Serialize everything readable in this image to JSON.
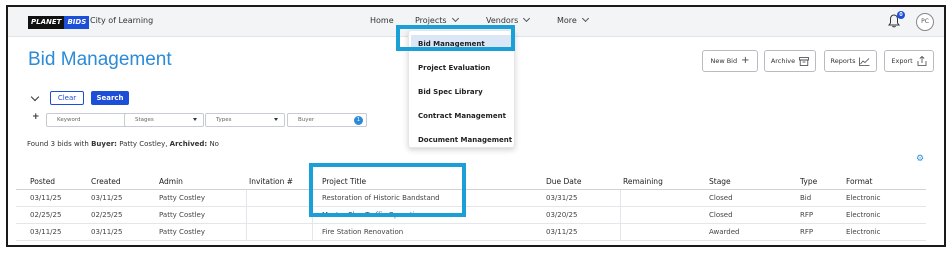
{
  "topbar": {
    "logo_part1": "PLANET",
    "logo_part2": "BIDS",
    "org_name": "City of Learning",
    "nav": [
      {
        "label": "Home",
        "has_chevron": false
      },
      {
        "label": "Projects",
        "has_chevron": true
      },
      {
        "label": "Vendors",
        "has_chevron": true
      },
      {
        "label": "More",
        "has_chevron": true
      }
    ],
    "notification_count": "0",
    "avatar_initials": "PC"
  },
  "page_title": "Bid Management",
  "actions": {
    "new_bid": "New Bid",
    "archive": "Archive",
    "reports": "Reports",
    "export": "Export"
  },
  "filters": {
    "clear_label": "Clear",
    "search_label": "Search",
    "keyword_placeholder": "Keyword",
    "stages_placeholder": "Stages",
    "types_placeholder": "Types",
    "buyer_placeholder": "Buyer",
    "buyer_count": "1"
  },
  "results_summary": {
    "prefix": "Found 3 bids with",
    "buyer_label": "Buyer:",
    "buyer_value": "Patty Costley,",
    "archived_label": "Archived:",
    "archived_value": "No"
  },
  "table": {
    "columns": [
      "Posted",
      "Created",
      "Admin",
      "Invitation #",
      "Project Title",
      "Due Date",
      "Remaining",
      "Stage",
      "Type",
      "Format"
    ],
    "rows": [
      [
        "03/11/25",
        "03/11/25",
        "Patty Costley",
        "",
        "Restoration of Historic Bandstand",
        "03/31/25",
        "",
        "Closed",
        "Bid",
        "Electronic"
      ],
      [
        "02/25/25",
        "02/25/25",
        "Patty Costley",
        "",
        "Master Plan Traffic Operations",
        "03/20/25",
        "",
        "Closed",
        "RFP",
        "Electronic"
      ],
      [
        "03/11/25",
        "03/11/25",
        "Patty Costley",
        "",
        "Fire Station Renovation",
        "03/11/25",
        "",
        "Awarded",
        "RFP",
        "Electronic"
      ]
    ]
  },
  "projects_menu": {
    "items": [
      "Bid Management",
      "Project Evaluation",
      "Bid Spec Library",
      "Contract Management",
      "Document Management"
    ],
    "active_index": 0
  },
  "colors": {
    "accent": "#1d4ed8",
    "title_blue": "#2b8bd8",
    "highlight": "#1b9fd7"
  }
}
